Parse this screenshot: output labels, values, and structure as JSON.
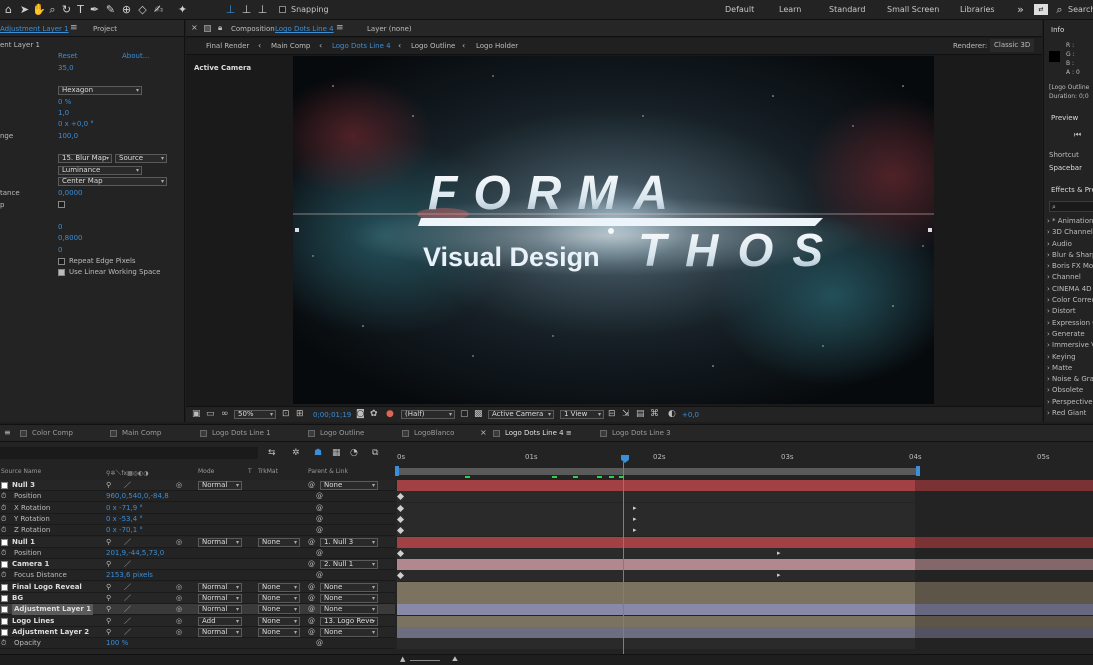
{
  "toolbar": {
    "snapping_label": "Snapping",
    "workspaces": [
      "Default",
      "Learn",
      "Standard",
      "Small Screen",
      "Libraries"
    ],
    "search_label": "Search"
  },
  "left_panel": {
    "tab_effect": "Adjustment Layer 1",
    "tab_project": "Project",
    "layer_label": "ent Layer 1",
    "reset": "Reset",
    "about": "About...",
    "v1": "35,0",
    "shape": "Hexagon",
    "v2": "0 %",
    "v3": "1,0",
    "v4": "0 x +0,0 °",
    "range_label": "nge",
    "v5": "100,0",
    "layer_select": "15. Blur Map",
    "source_select": "Source",
    "channel_select": "Luminance",
    "map_select": "Center Map",
    "distance_label": "tance",
    "v6": "0,0000",
    "p_label": "p",
    "v7": "0",
    "v8": "0,8000",
    "v9": "0",
    "repeat_edge": "Repeat Edge Pixels",
    "linear_ws": "Use Linear Working Space"
  },
  "comp_panel": {
    "title_prefix": "Composition",
    "comp_name": "Logo Dots Line 4",
    "layer_none": "Layer (none)",
    "breadcrumbs": [
      "Final Render",
      "Main Comp",
      "Logo Dots Line 4",
      "Logo Outline",
      "Logo Holder"
    ],
    "renderer_label": "Renderer:",
    "renderer_value": "Classic 3D",
    "active_camera": "Active Camera",
    "logo_line1": "FORMA",
    "logo_line2": "Visual Design",
    "logo_line3": "THOS",
    "zoom": "50%",
    "timecode": "0;00;01;19",
    "resolution": "(Half)",
    "camera_select": "Active Camera",
    "view_select": "1 View",
    "exposure": "+0,0"
  },
  "right_panel": {
    "info": "Info",
    "r": "R :",
    "g": "G :",
    "b": "B :",
    "a": "A : 0",
    "layer_info": "[Logo Outline",
    "duration": "Duration: 0;0",
    "preview": "Preview",
    "shortcut": "Shortcut",
    "shortcut_value": "Spacebar",
    "effects": "Effects & Pre",
    "effects_list": [
      "* Animation",
      "3D Channel",
      "Audio",
      "Blur & Sharp",
      "Boris FX Mo",
      "Channel",
      "CINEMA 4D",
      "Color Correc",
      "Distort",
      "Expression C",
      "Generate",
      "Immersive V",
      "Keying",
      "Matte",
      "Noise & Gra",
      "Obsolete",
      "Perspective",
      "Red Giant"
    ]
  },
  "timeline": {
    "tabs": [
      "Color Comp",
      "Main Comp",
      "Logo Dots Line 1",
      "Logo Outline",
      "LogoBlanco",
      "Logo Dots Line 4",
      "Logo Dots Line 3"
    ],
    "active_tab": "Logo Dots Line 4",
    "headers": {
      "source": "Source Name",
      "mode": "Mode",
      "t": "T",
      "trkmat": "TrkMat",
      "parent": "Parent & Link"
    },
    "ruler": [
      "0s",
      "01s",
      "02s",
      "03s",
      "04s",
      "05s"
    ],
    "layers": [
      {
        "name": "Null 3",
        "type": "layer",
        "mode": "Normal",
        "trkmat": "",
        "parent": "None",
        "color": "#b8474a"
      },
      {
        "name": "Position",
        "type": "prop",
        "value": "960,0,540,0,-84,8"
      },
      {
        "name": "X Rotation",
        "type": "prop",
        "value": "0 x -71,9 °"
      },
      {
        "name": "Y Rotation",
        "type": "prop",
        "value": "0 x -53,4 °"
      },
      {
        "name": "Z Rotation",
        "type": "prop",
        "value": "0 x -70,1 °"
      },
      {
        "name": "Null 1",
        "type": "layer",
        "mode": "Normal",
        "trkmat": "None",
        "parent": "1. Null 3",
        "color": "#b8474a"
      },
      {
        "name": "Position",
        "type": "prop",
        "value": "201,9,-44,5,73,0"
      },
      {
        "name": "Camera 1",
        "type": "layer",
        "mode": "",
        "trkmat": "",
        "parent": "2. Null 1",
        "color": "#c99aa0"
      },
      {
        "name": "Focus Distance",
        "type": "prop",
        "value": "2153,6 pixels"
      },
      {
        "name": "Final Logo Reveal",
        "type": "layer",
        "mode": "Normal",
        "trkmat": "None",
        "parent": "None",
        "color": "#8b806a"
      },
      {
        "name": "BG",
        "type": "layer",
        "mode": "Normal",
        "trkmat": "None",
        "parent": "None",
        "color": "#8b806a"
      },
      {
        "name": "Adjustment Layer 1",
        "type": "layer",
        "mode": "Normal",
        "trkmat": "None",
        "parent": "None",
        "color": "#9a9ac0"
      },
      {
        "name": "Logo Lines",
        "type": "layer",
        "mode": "Add",
        "trkmat": "None",
        "parent": "13. Logo Reve",
        "color": "#8b806a"
      },
      {
        "name": "Adjustment Layer 2",
        "type": "layer",
        "mode": "Normal",
        "trkmat": "None",
        "parent": "None",
        "color": "#7a7a90"
      },
      {
        "name": "Opacity",
        "type": "prop",
        "value": "100 %"
      }
    ],
    "colors": {
      "accent": "#3b8ed8",
      "playhead": "#3b8ed8"
    }
  }
}
